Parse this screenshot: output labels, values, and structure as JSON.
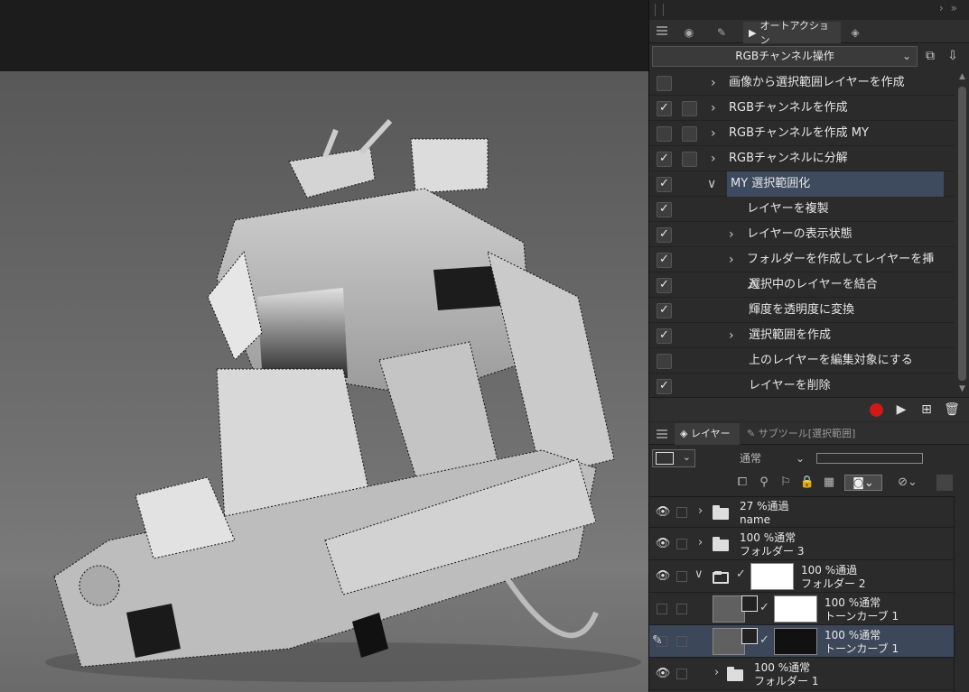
{
  "panel": {
    "tabs": [
      "record-tab-icon",
      "brush-tab-icon",
      "auto-action-tab",
      "stack-tab-icon"
    ],
    "auto_action_tab_label": "オートアクション",
    "action_set": "RGBチャンネル操作"
  },
  "actions": [
    {
      "label": "画像から選択範囲レイヤーを作成",
      "checked": false,
      "chevron": ">"
    },
    {
      "label": "RGBチャンネルを作成",
      "checked": true,
      "chevron": ">"
    },
    {
      "label": "RGBチャンネルを作成 MY",
      "checked": false,
      "chevron": ">"
    },
    {
      "label": "RGBチャンネルに分解",
      "checked": true,
      "chevron": ">"
    },
    {
      "label": "MY 選択範囲化",
      "checked": true,
      "chevron": "∨"
    },
    {
      "label": "レイヤーを複製",
      "checked": true,
      "chevron": ""
    },
    {
      "label": "レイヤーの表示状態",
      "checked": true,
      "chevron": ">"
    },
    {
      "label": "フォルダーを作成してレイヤーを挿入",
      "checked": true,
      "chevron": ">"
    },
    {
      "label": "選択中のレイヤーを結合",
      "checked": true,
      "chevron": ""
    },
    {
      "label": "輝度を透明度に変換",
      "checked": true,
      "chevron": ""
    },
    {
      "label": "選択範囲を作成",
      "checked": true,
      "chevron": ">"
    },
    {
      "label": "上のレイヤーを編集対象にする",
      "checked": false,
      "chevron": ""
    },
    {
      "label": "レイヤーを削除",
      "checked": true,
      "chevron": ""
    }
  ],
  "layer_panel": {
    "tab_layer": "レイヤー",
    "tab_subtool": "サブツール[選択範囲]",
    "blend_mode": "通常"
  },
  "layers": [
    {
      "mode": "27 %通過",
      "name": "name"
    },
    {
      "mode": "100 %通常",
      "name": "フォルダー 3"
    },
    {
      "mode": "100 %通過",
      "name": "フォルダー 2"
    },
    {
      "mode": "100 %通常",
      "name": "トーンカーブ 1"
    },
    {
      "mode": "100 %通常",
      "name": "トーンカーブ 1"
    },
    {
      "mode": "100 %通常",
      "name": "フォルダー 1"
    }
  ],
  "colors": {
    "record": "#d01818",
    "selection": "#3e4a5e"
  }
}
